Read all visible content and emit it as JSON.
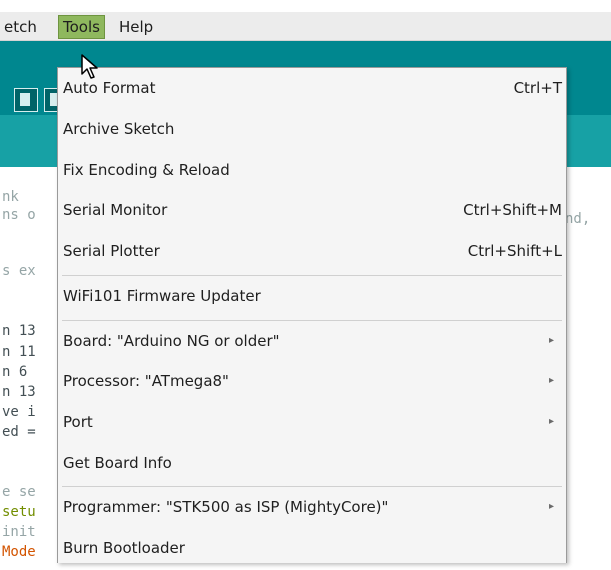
{
  "menubar": {
    "sketch_label": "etch",
    "tools_label": "Tools",
    "help_label": "Help"
  },
  "editor": {
    "lines": [
      {
        "text": "nk"
      },
      {
        "text": "ns o"
      },
      {
        "text": "s ex"
      },
      {
        "text": "n 13"
      },
      {
        "text": "n 11"
      },
      {
        "text": "n 6"
      },
      {
        "text": "n 13"
      },
      {
        "text": "ve i"
      },
      {
        "text": "ed ="
      },
      {
        "text": "e se"
      },
      {
        "text": "setu"
      },
      {
        "text": "init"
      },
      {
        "text": "Mode"
      }
    ],
    "right_fragment": "nd,"
  },
  "tools_menu": {
    "items": [
      {
        "label": "Auto Format",
        "shortcut": "Ctrl+T"
      },
      {
        "label": "Archive Sketch",
        "shortcut": ""
      },
      {
        "label": "Fix Encoding & Reload",
        "shortcut": ""
      },
      {
        "label": "Serial Monitor",
        "shortcut": "Ctrl+Shift+M"
      },
      {
        "label": "Serial Plotter",
        "shortcut": "Ctrl+Shift+L"
      },
      {
        "label": "WiFi101 Firmware Updater",
        "shortcut": ""
      },
      {
        "label": "Board: \"Arduino NG or older\"",
        "shortcut": "",
        "submenu": "▸"
      },
      {
        "label": "Processor: \"ATmega8\"",
        "shortcut": "",
        "submenu": "▸"
      },
      {
        "label": "Port",
        "shortcut": "",
        "submenu": "▸"
      },
      {
        "label": "Get Board Info",
        "shortcut": ""
      },
      {
        "label": "Programmer: \"STK500 as ISP (MightyCore)\"",
        "shortcut": "",
        "submenu": "▸"
      },
      {
        "label": "Burn Bootloader",
        "shortcut": ""
      }
    ]
  },
  "colors": {
    "toolbar": "#00878f",
    "tabstrip": "#17a1a5",
    "tools_highlight": "#8fb85e"
  },
  "icons": {
    "cursor": "arrow-cursor-icon",
    "submenu": "submenu-arrow-icon"
  }
}
